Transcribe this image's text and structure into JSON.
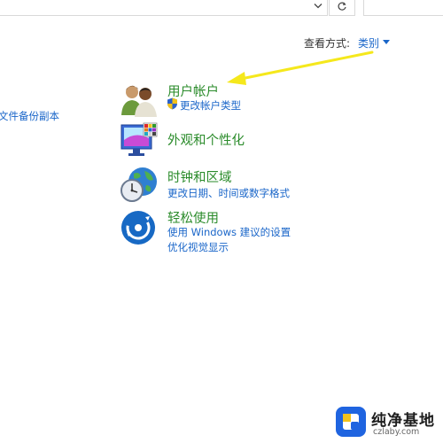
{
  "view_by": {
    "label": "查看方式:",
    "value": "类别"
  },
  "left_panel": {
    "link_partial": "文件备份副本"
  },
  "categories": [
    {
      "title": "用户帐户",
      "icon": "user-accounts-icon",
      "links": [
        "更改帐户类型"
      ]
    },
    {
      "title": "外观和个性化",
      "icon": "appearance-icon",
      "links": []
    },
    {
      "title": "时钟和区域",
      "icon": "clock-region-icon",
      "links": [
        "更改日期、时间或数字格式"
      ]
    },
    {
      "title": "轻松使用",
      "icon": "ease-of-access-icon",
      "links": [
        "使用 Windows 建议的设置",
        "优化视觉显示"
      ]
    }
  ],
  "annotation": {
    "arrow_color": "#f5e81c"
  },
  "watermark": {
    "title": "纯净基地",
    "subtitle": "czlaby.com"
  },
  "colors": {
    "category_title": "#2a8b2a",
    "link": "#1a66c9"
  }
}
